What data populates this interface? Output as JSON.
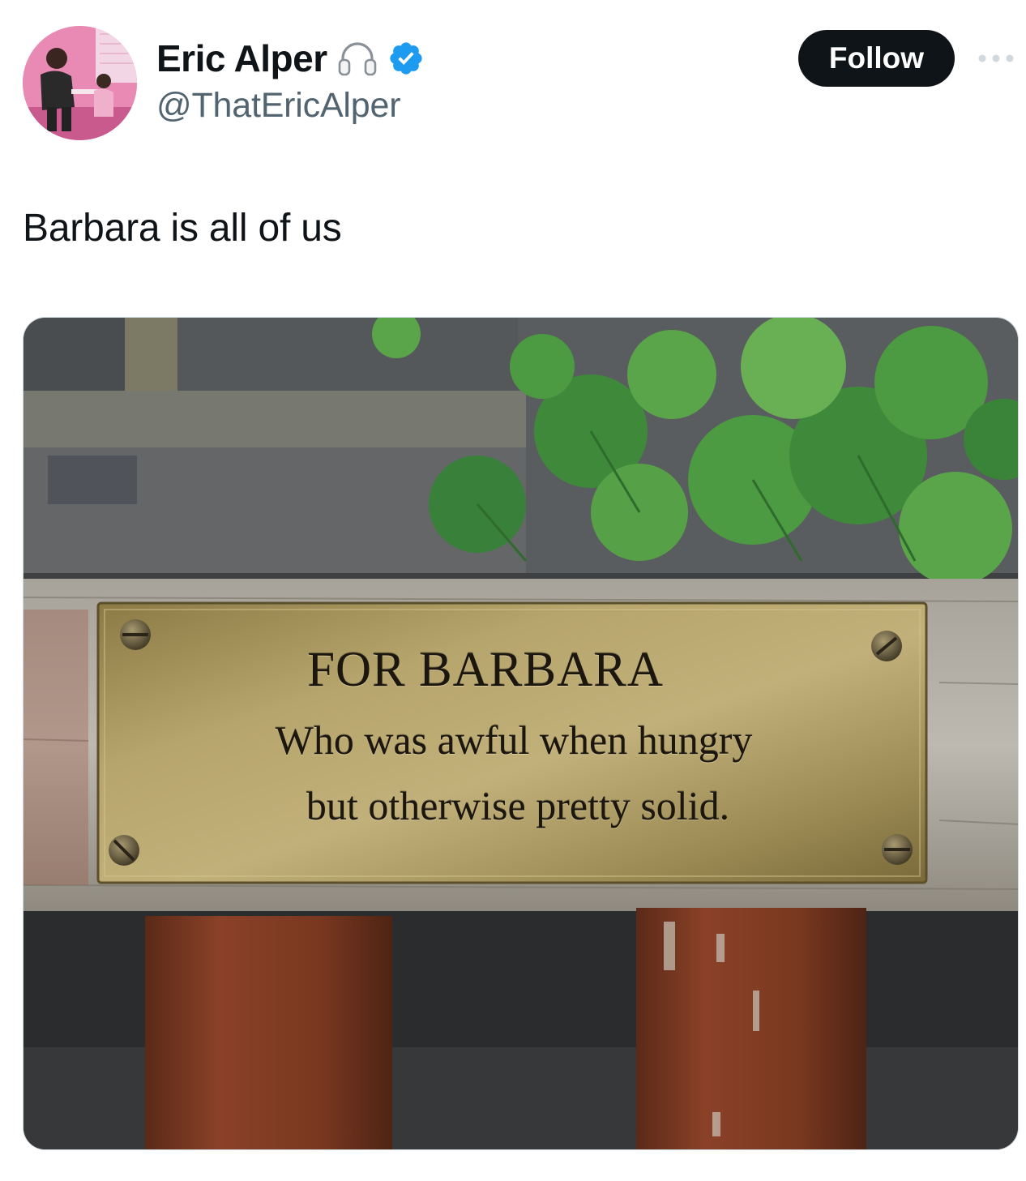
{
  "tweet": {
    "author": {
      "display_name": "Eric Alper",
      "handle": "@ThatEricAlper",
      "badge_icon": "headphones-icon",
      "verified_icon": "verified-badge-icon"
    },
    "follow_label": "Follow",
    "more_icon": "more-options-icon",
    "text": "Barbara is all of us",
    "media": {
      "plaque": {
        "title": "FOR BARBARA",
        "line1": "Who was awful when hungry",
        "line2": "but otherwise pretty solid."
      }
    }
  },
  "colors": {
    "text_primary": "#0f1419",
    "text_secondary": "#536471",
    "follow_button_bg": "#0f1419",
    "verified_blue": "#1d9bf0"
  }
}
